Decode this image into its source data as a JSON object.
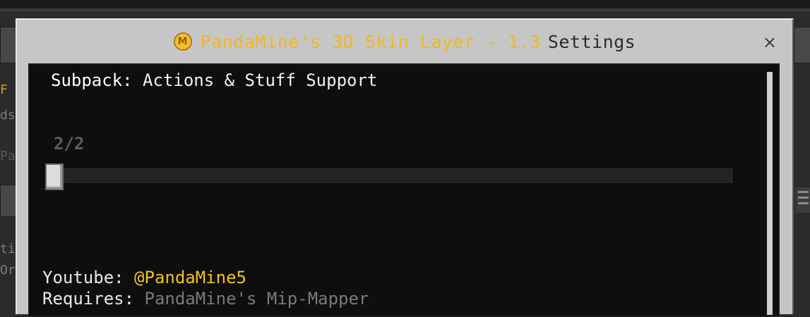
{
  "dialog": {
    "title_brand": "PandaMine's 3D Skin Layer - 1.3",
    "title_rest": "Settings",
    "coin_letter": "M",
    "close_symbol": "×"
  },
  "subpack": {
    "label": "Subpack:",
    "value": "Actions & Stuff Support"
  },
  "slider": {
    "value_text": "2/2",
    "position_fraction": 0
  },
  "info": {
    "youtube_label": "Youtube:",
    "youtube_value": "@PandaMine5",
    "requires_label": "Requires:",
    "requires_value": "PandaMine's Mip-Mapper"
  },
  "background": {
    "left_text_1": "F",
    "left_text_2": "ds",
    "left_text_3": "Pa",
    "left_text_4": "ti",
    "left_text_5": "Or"
  },
  "colors": {
    "brand": "#f2b81c",
    "youtube": "#f2c11e",
    "dialog_frame": "#c6c6c6",
    "content_bg": "#0e0e0e"
  }
}
